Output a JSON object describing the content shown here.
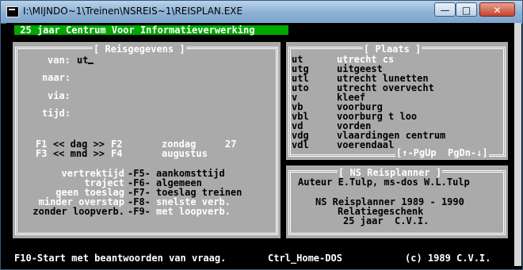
{
  "window": {
    "title": "I:\\MIJNDO~1\\Treinen\\NSREIS~1\\REISPLAN.EXE",
    "buttons": {
      "minimize": "—",
      "maximize": "□",
      "close": "✕"
    }
  },
  "header": {
    "banner": " 25 jaar Centrum Voor Informatieverwerking "
  },
  "reisgegevens": {
    "title": "[ Reisgegevens ]",
    "van_label": "van:",
    "van_value": "ut",
    "naar_label": "naar:",
    "via_label": "via:",
    "tijd_label": "tijd:",
    "f1": "F1",
    "dag": "<< dag >>",
    "f2": "F2",
    "f3": "F3",
    "mnd": "<< mnd >>",
    "f4": "F4",
    "weekday": "zondag",
    "day": "27",
    "month": "augustus",
    "options": [
      {
        "left": "vertrektijd",
        "key": "-F5-",
        "right": "aankomsttijd"
      },
      {
        "left": "traject",
        "key": "-F6-",
        "right": "algemeen"
      },
      {
        "left": "geen toeslag",
        "key": "-F7-",
        "right": "toeslag treinen"
      },
      {
        "left": "minder overstap",
        "key": "-F8-",
        "right": "snelste verb."
      },
      {
        "left": "zonder loopverb.",
        "key": "-F9-",
        "right": "met loopverb."
      }
    ]
  },
  "plaats": {
    "title": "[ Plaats ]",
    "rows": [
      {
        "code": "ut",
        "name": "utrecht cs"
      },
      {
        "code": "utg",
        "name": "uitgeest"
      },
      {
        "code": "utl",
        "name": "utrecht lunetten"
      },
      {
        "code": "uto",
        "name": "utrecht overvecht"
      },
      {
        "code": "v",
        "name": "kleef"
      },
      {
        "code": "vb",
        "name": "voorburg"
      },
      {
        "code": "vbl",
        "name": "voorburg t loo"
      },
      {
        "code": "vd",
        "name": "vorden"
      },
      {
        "code": "vdg",
        "name": "vlaardingen centrum"
      },
      {
        "code": "vdl",
        "name": "voerendaal"
      }
    ],
    "pager": "[↑-PgUp  PgDn-↓]"
  },
  "about": {
    "title": "[ NS Reisplanner ]",
    "author": "Auteur E.Tulp, ms-dos W.L.Tulp",
    "line1": "NS Reisplanner 1989 - 1990",
    "line2": "Relatiegeschenk",
    "line3": "25 jaar  C.V.I."
  },
  "statusbar": {
    "left": "F10-Start met beantwoorden van vraag.",
    "middle": "Ctrl_Home-DOS",
    "right": "(c) 1989 C.V.I."
  }
}
